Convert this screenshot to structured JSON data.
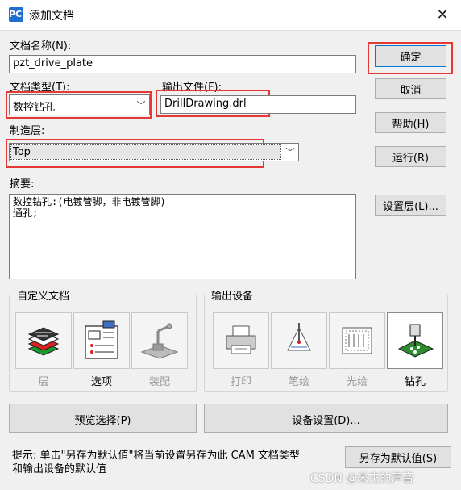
{
  "window": {
    "title": "添加文档",
    "app_icon": "PCB",
    "close_icon": "✕"
  },
  "form": {
    "doc_name_label": "文档名称(N):",
    "doc_name_value": "pzt_drive_plate",
    "doc_type_label": "文档类型(T):",
    "doc_type_value": "数控钻孔",
    "output_file_label": "输出文件(F):",
    "output_file_value": "DrillDrawing.drl",
    "layer_label": "制造层:",
    "layer_value": "Top",
    "summary_label": "摘要:",
    "summary_value": "数控钻孔:(电镀管脚，非电镀管脚)\n通孔;"
  },
  "buttons": {
    "ok": "确定",
    "cancel": "取消",
    "help": "帮助(H)",
    "run": "运行(R)",
    "set_layers": "设置层(L)...",
    "preview_select": "预览选择(P)",
    "device_settings": "设备设置(D)...",
    "save_default": "另存为默认值(S)"
  },
  "custom_doc": {
    "title": "自定义文档",
    "tiles": [
      {
        "label": "层",
        "icon": "layers-icon",
        "enabled": false
      },
      {
        "label": "选项",
        "icon": "options-icon",
        "enabled": true
      },
      {
        "label": "装配",
        "icon": "assembly-icon",
        "enabled": false
      }
    ]
  },
  "output_device": {
    "title": "输出设备",
    "tiles": [
      {
        "label": "打印",
        "icon": "printer-icon",
        "enabled": false
      },
      {
        "label": "笔绘",
        "icon": "pen-plotter-icon",
        "enabled": false
      },
      {
        "label": "光绘",
        "icon": "photo-plotter-icon",
        "enabled": false
      },
      {
        "label": "钻孔",
        "icon": "drill-icon",
        "enabled": true,
        "selected": true
      }
    ]
  },
  "footer": {
    "hint": "提示: 单击\"另存为默认值\"将当前设置另存为此 CAM 文档类型\n和输出设备的默认值",
    "watermark": "CSDN @米杰的声音"
  },
  "colors": {
    "highlight_border": "#e53935",
    "window_bg": "#f0f0f0"
  }
}
